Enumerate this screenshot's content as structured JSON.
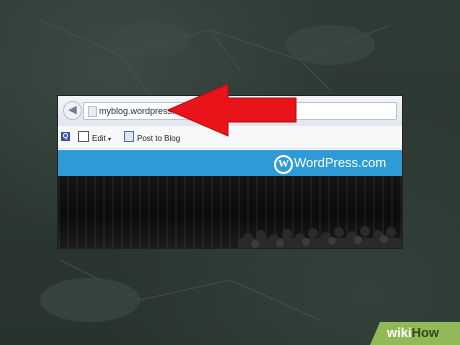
{
  "browser": {
    "back_icon": "back-arrow-icon",
    "address_url": "myblog.wordpress.com/"
  },
  "toolbar": {
    "edit_label": "Edit",
    "edit_dropdown": "▾",
    "post_label": "Post to Blog"
  },
  "banner": {
    "brand_text": "WordPress.com",
    "logo_letter": "W",
    "color": "#2e9ad6"
  },
  "annotation": {
    "arrow_color": "#e8141a",
    "arrow_icon": "red-arrow-pointing-left"
  },
  "watermark": {
    "wiki": "wiki",
    "how": "How",
    "color": "#93b858"
  }
}
